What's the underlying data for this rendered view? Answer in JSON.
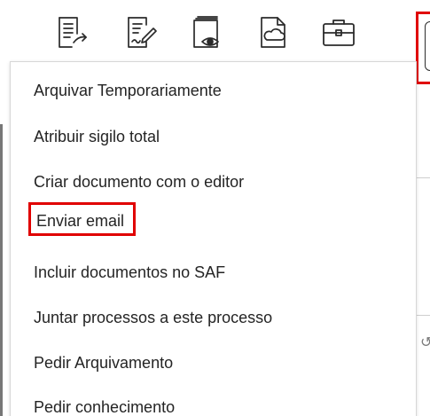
{
  "toolbar": {
    "icons": [
      "document-share-icon",
      "document-sign-icon",
      "document-view-icon",
      "cloud-document-icon",
      "briefcase-icon"
    ],
    "more_button_icon": "more-vertical-icon",
    "highlight_color": "#e00000"
  },
  "menu": {
    "items": [
      {
        "label": "Arquivar Temporariamente"
      },
      {
        "label": "Atribuir sigilo total"
      },
      {
        "label": "Criar documento com o editor"
      },
      {
        "label": "Enviar email"
      },
      {
        "label": "Incluir documentos no SAF"
      },
      {
        "label": "Juntar processos a este processo"
      },
      {
        "label": "Pedir Arquivamento"
      },
      {
        "label": "Pedir conhecimento"
      }
    ]
  }
}
